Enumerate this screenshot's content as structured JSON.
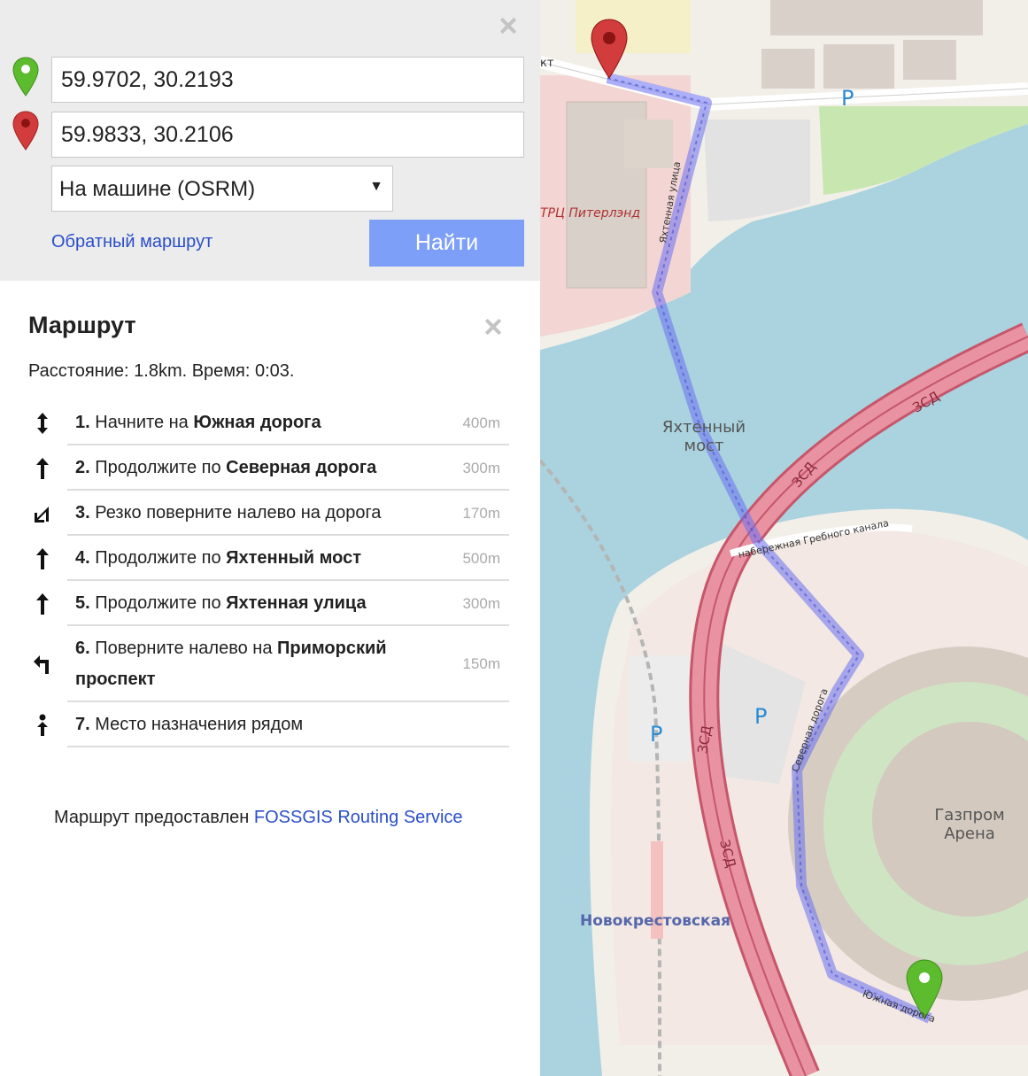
{
  "search": {
    "from_value": "59.9702, 30.2193",
    "to_value": "59.9833, 30.2106",
    "mode_label": "На машине (OSRM)",
    "reverse_label": "Обратный маршрут",
    "go_label": "Найти"
  },
  "route": {
    "title": "Маршрут",
    "summary": "Расстояние: 1.8km. Время: 0:03.",
    "steps": [
      {
        "num": "1.",
        "text": "Начните на",
        "street": "Южная дорога",
        "dist": "400m",
        "icon": "start-arrow-icon"
      },
      {
        "num": "2.",
        "text": "Продолжите по",
        "street": "Северная дорога",
        "dist": "300m",
        "icon": "straight-arrow-icon"
      },
      {
        "num": "3.",
        "text": "Резко поверните налево на дорога",
        "street": "",
        "dist": "170m",
        "icon": "sharp-left-icon"
      },
      {
        "num": "4.",
        "text": "Продолжите по",
        "street": "Яхтенный мост",
        "dist": "500m",
        "icon": "straight-arrow-icon"
      },
      {
        "num": "5.",
        "text": "Продолжите по",
        "street": "Яхтенная улица",
        "dist": "300m",
        "icon": "straight-arrow-icon"
      },
      {
        "num": "6.",
        "text": "Поверните налево на",
        "street": "Приморский проспект",
        "dist": "150m",
        "icon": "turn-left-icon"
      },
      {
        "num": "7.",
        "text": "Место назначения рядом",
        "street": "",
        "dist": "",
        "icon": "destination-icon"
      }
    ]
  },
  "attribution": {
    "prefix": "Маршрут предоставлен",
    "link": "FOSSGIS Routing Service"
  },
  "map": {
    "labels": {
      "mall": "ТРЦ Питерлэнд",
      "bridge": "Яхтенный мост",
      "zsd1": "ЗСД",
      "zsd2": "ЗСД",
      "zsd3": "ЗСД",
      "zsd4": "ЗСД",
      "street_yakhtennaya": "Яхтенная улица",
      "embankment": "набережная Гребного канала",
      "severnaya": "Северная дорога",
      "yuzhnaya": "Южная дорога",
      "arena": "Газпром Арена",
      "station": "Новокрестовская",
      "parking": "P",
      "street_stub": "кт"
    },
    "colors": {
      "water": "#aad3df",
      "land": "#f2efe9",
      "motorway": "#e892a2",
      "route": "#7b7ff0",
      "start_pin": "#5dbb2e",
      "end_pin": "#d23c3c"
    }
  }
}
